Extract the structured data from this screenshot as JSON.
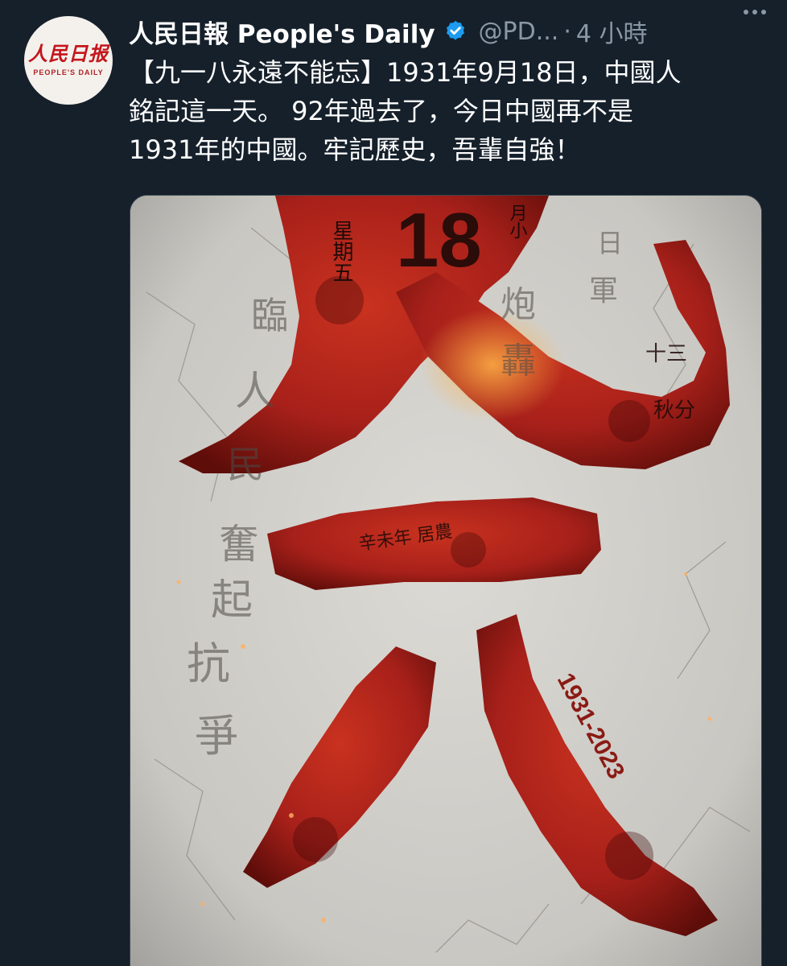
{
  "tweet": {
    "author": {
      "display_name": "人民日報 People's Daily",
      "handle": "@PD...",
      "separator": "·",
      "time": "4 小時",
      "avatar": {
        "logo_cn": "人民日报",
        "logo_en": "PEOPLE'S DAILY"
      },
      "verified": true
    },
    "text_lines": [
      "【九一八永遠不能忘】1931年9月18日，中國人",
      "銘記這一天。 92年過去了，今日中國再不是",
      "1931年的中國。牢記歷史，吾輩自強！"
    ],
    "media": {
      "main_characters": "九一八",
      "calendar_day": "18",
      "calendar_weekday": "星期五",
      "calendar_month": "月小",
      "years": "1931-2023",
      "calligraphy_left": [
        "臨",
        "人",
        "民",
        "奮",
        "起",
        "抗",
        "爭"
      ],
      "calligraphy_right": [
        "日",
        "軍",
        "炮",
        "轟",
        "十三",
        "秋分"
      ],
      "calligraphy_center": "辛未年 居農",
      "colors": {
        "red": "#b3231a",
        "dark_red": "#6e0f0a",
        "wall": "#d6d4cf"
      }
    }
  },
  "theme": {
    "background": "#15202b",
    "muted": "#8b98a5",
    "verified": "#1d9bf0"
  }
}
